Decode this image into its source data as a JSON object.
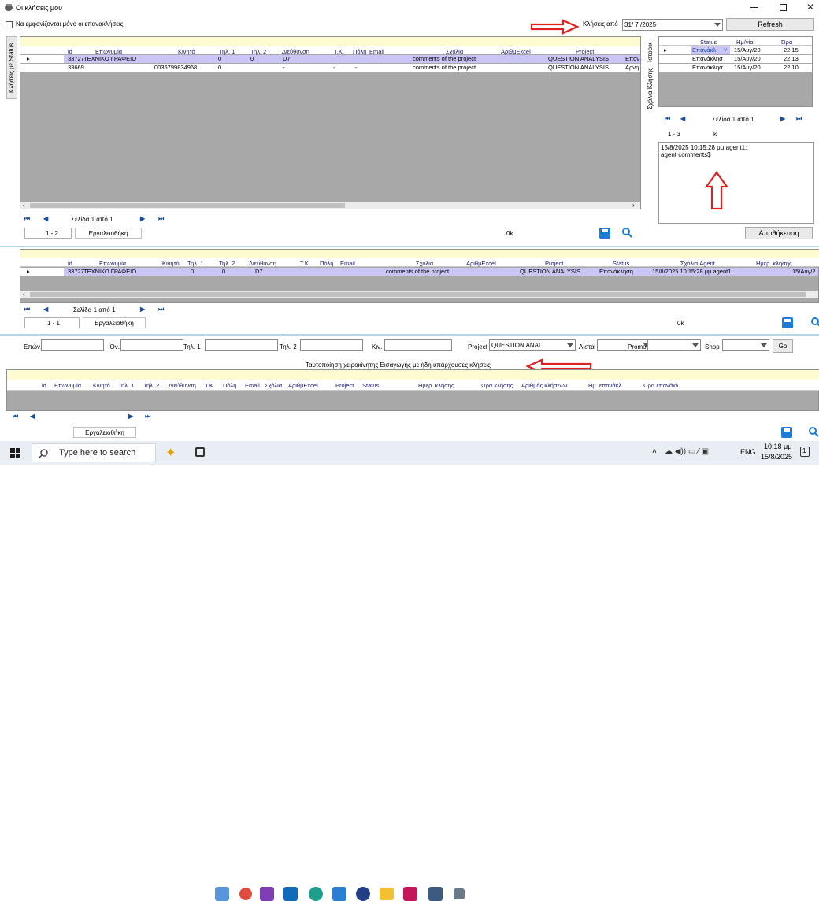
{
  "window": {
    "title": "Οι κλήσεις μου",
    "checkbox_label": "Να εμφανίζονται μόνο οι επανακλήσεις",
    "calls_from_label": "Κλήσεις από",
    "calls_from_value": "31/ 7 /2025",
    "refresh_label": "Refresh"
  },
  "side_tab_calls": "Κλήσεις με Status",
  "side_tab_history": "Σχόλια Κλήσης - Ιστορικ",
  "grid1": {
    "columns": [
      "id",
      "Επωνυμία",
      "Κινητό",
      "Τηλ. 1",
      "Τηλ. 2",
      "Διεύθυνση",
      "Τ.Κ.",
      "Πόλη",
      "Email",
      "Σχόλια",
      "ΑριθμExcel",
      "Project"
    ],
    "rows": [
      {
        "id": "33727",
        "name": "ΤΕΧΝΙΚΟ ΓΡΑΦΕΙΟ",
        "mobile": "",
        "t1": "0",
        "t2": "0",
        "addr": "D7",
        "tk": "",
        "city": "",
        "email": "",
        "comments": "comments of the project",
        "excel": "",
        "project": "QUESTION ANALYSIS",
        "extra": "Επαν"
      },
      {
        "id": "33669",
        "name": "",
        "mobile": "0035799834968",
        "t1": "0",
        "t2": "",
        "addr": "-",
        "tk": "-",
        "city": "-",
        "email": "",
        "comments": "comments of the project",
        "excel": "",
        "project": "QUESTION ANALYSIS",
        "extra": "Αρνη"
      }
    ],
    "page_text": "Σελίδα 1 από 1",
    "range_text": "1 - 2",
    "toolbox_label": "Εργαλειοθήκη",
    "ok_text": "0k"
  },
  "history": {
    "columns": [
      "Status",
      "Ημ/νία",
      "Ώρα"
    ],
    "rows": [
      {
        "status": "Επανάκλ",
        "date": "15/Αυγ/20",
        "time": "22:15"
      },
      {
        "status": "Επανάκλησ",
        "date": "15/Αυγ/20",
        "time": "22:13"
      },
      {
        "status": "Επανάκλησ",
        "date": "15/Αυγ/20",
        "time": "22:10"
      }
    ],
    "page_text": "Σελίδα 1 από 1",
    "range_text": "1 - 3",
    "k_text": "k",
    "comment_line1": "15/8/2025 10:15:28 μμ agent1:",
    "comment_line2": "agent comments$",
    "save_label": "Αποθήκευση"
  },
  "grid2": {
    "columns": [
      "id",
      "Επωνυμία",
      "Κινητό",
      "Τηλ. 1",
      "Τηλ. 2",
      "Διεύθυνση",
      "Τ.Κ.",
      "Πόλη",
      "Email",
      "Σχόλια",
      "ΑριθμExcel",
      "Project",
      "Status",
      "Σχόλια Agent",
      "Ημερ. κλήσης"
    ],
    "row": {
      "id": "33727",
      "name": "ΤΕΧΝΙΚΟ ΓΡΑΦΕΙΟ",
      "t1": "0",
      "t2": "0",
      "addr": "D7",
      "comments": "comments of the project",
      "project": "QUESTION ANALYSIS",
      "status": "Επανάκληση",
      "agent": "15/8/2025 10:15:28 μμ agent1:",
      "date": "15/Αυγ/2"
    },
    "page_text": "Σελίδα 1 από 1",
    "range_text": "1 - 1",
    "toolbox_label": "Εργαλειοθήκη",
    "ok_text": "0k"
  },
  "search": {
    "surname_label": "Επών.",
    "firstname_label": "'Ον.",
    "phone1_label": "Τηλ. 1",
    "phone2_label": "Τηλ. 2",
    "mobile_label": "Κιν.",
    "project_label": "Project",
    "project_value": "QUESTION ANAL",
    "list_label": "Λίστα",
    "promo_label": "Promo",
    "shop_label": "Shop",
    "go_label": "Go"
  },
  "grid3": {
    "caption": "Ταυτοποίηση χειροκίνητης Εισαγωγής με ήδη υπάρχουσες κλήσεις",
    "columns": [
      "id",
      "Επωνυμία",
      "Κινητό",
      "Τηλ. 1",
      "Τηλ. 2",
      "Διεύθυνση",
      "Τ.Κ.",
      "Πόλη",
      "Email",
      "Σχόλια",
      "ΑριθμExcel",
      "Project",
      "Status",
      "Ημερ. κλήσης",
      "Ώρα κλήσης",
      "Αριθμός κλήσεων",
      "Ημ. επανάκλ.",
      "Ώρα επανάκλ."
    ],
    "toolbox_label": "Εργαλειοθήκη"
  },
  "taskbar": {
    "search_placeholder": "Type here to search",
    "lang": "ENG",
    "time": "10:18 μμ",
    "date": "15/8/2025",
    "notif_count": "1"
  },
  "colors": {
    "accent": "#1a4fa0",
    "row_selected": "#c9c5f5",
    "header_yellow": "#fdfbd0",
    "grid_bg": "#a8a8a8",
    "arrow_red": "#e02020"
  }
}
